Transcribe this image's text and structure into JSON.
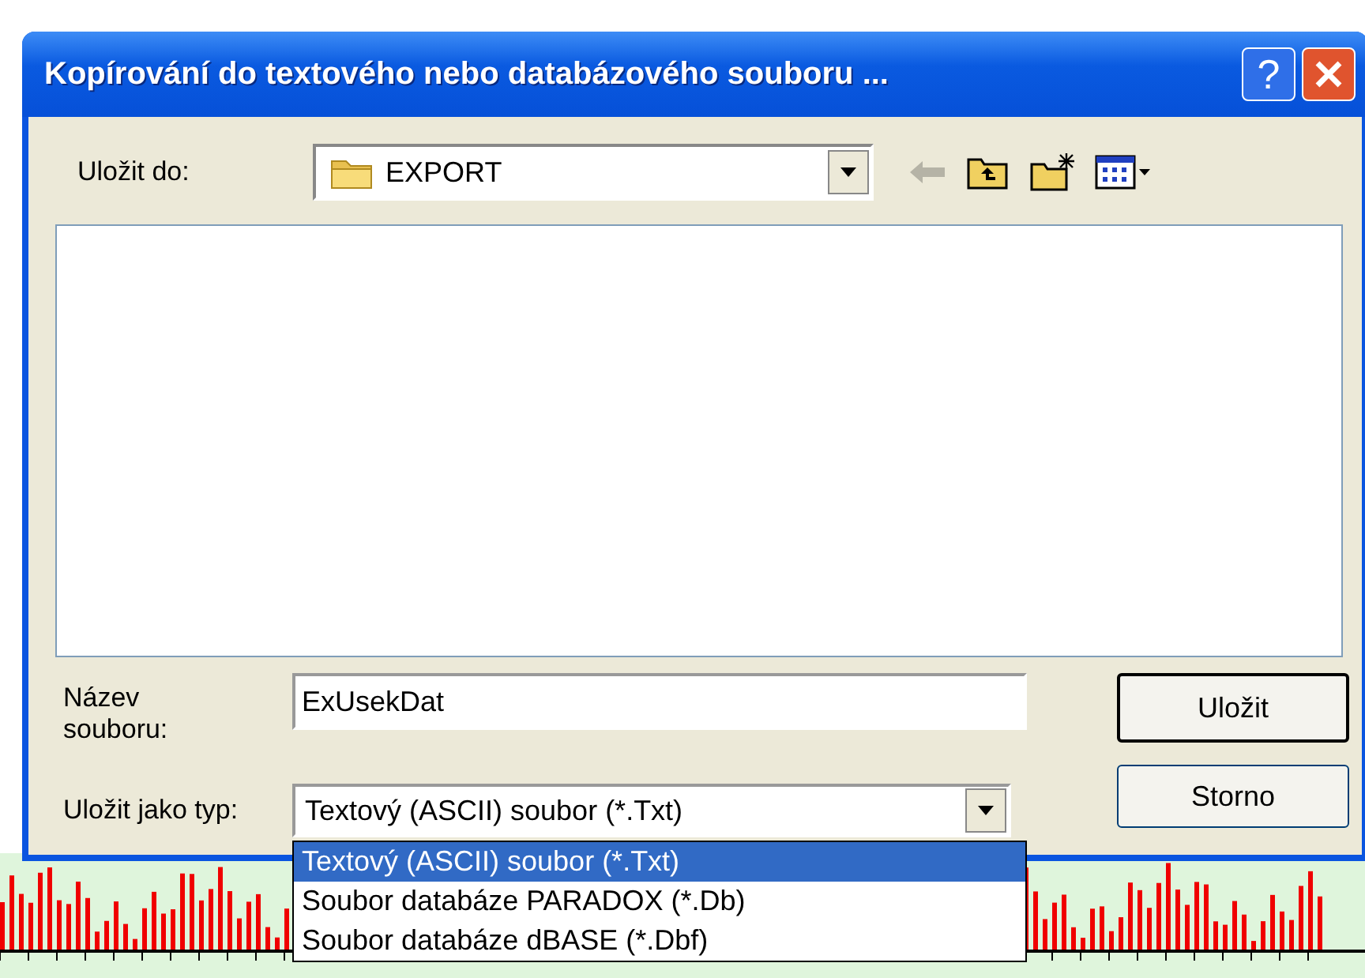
{
  "window": {
    "title": "Kopírování do textového nebo databázového souboru ...",
    "help": "?"
  },
  "save_in": {
    "label": "Uložit do:",
    "value": "EXPORT"
  },
  "file_name": {
    "label": "Název souboru:",
    "value": "ExUsekDat"
  },
  "file_type": {
    "label": "Uložit jako typ:",
    "value": "Textový (ASCII) soubor (*.Txt)",
    "expanded": true,
    "options": [
      {
        "label": "Textový (ASCII) soubor (*.Txt)",
        "selected": true
      },
      {
        "label": "Soubor databáze PARADOX (*.Db)",
        "selected": false
      },
      {
        "label": "Soubor databáze dBASE (*.Dbf)",
        "selected": false
      }
    ]
  },
  "buttons": [
    {
      "label": "Uložit",
      "default": true
    },
    {
      "label": "Storno",
      "default": false
    }
  ]
}
